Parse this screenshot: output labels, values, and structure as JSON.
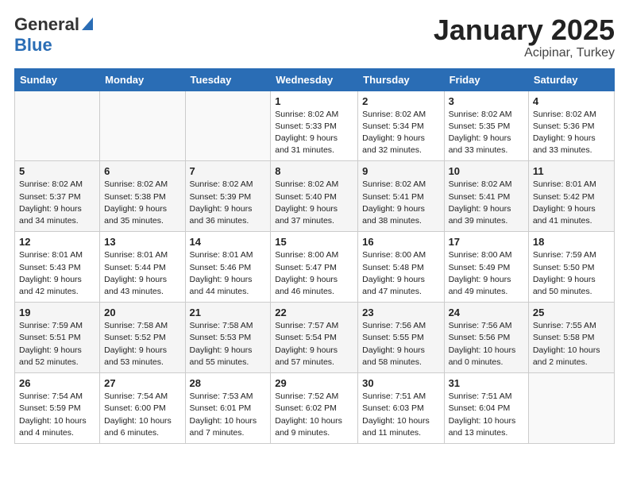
{
  "header": {
    "logo_line1": "General",
    "logo_line2": "Blue",
    "month": "January 2025",
    "location": "Acipinar, Turkey"
  },
  "days_of_week": [
    "Sunday",
    "Monday",
    "Tuesday",
    "Wednesday",
    "Thursday",
    "Friday",
    "Saturday"
  ],
  "weeks": [
    [
      {
        "day": "",
        "info": ""
      },
      {
        "day": "",
        "info": ""
      },
      {
        "day": "",
        "info": ""
      },
      {
        "day": "1",
        "info": "Sunrise: 8:02 AM\nSunset: 5:33 PM\nDaylight: 9 hours\nand 31 minutes."
      },
      {
        "day": "2",
        "info": "Sunrise: 8:02 AM\nSunset: 5:34 PM\nDaylight: 9 hours\nand 32 minutes."
      },
      {
        "day": "3",
        "info": "Sunrise: 8:02 AM\nSunset: 5:35 PM\nDaylight: 9 hours\nand 33 minutes."
      },
      {
        "day": "4",
        "info": "Sunrise: 8:02 AM\nSunset: 5:36 PM\nDaylight: 9 hours\nand 33 minutes."
      }
    ],
    [
      {
        "day": "5",
        "info": "Sunrise: 8:02 AM\nSunset: 5:37 PM\nDaylight: 9 hours\nand 34 minutes."
      },
      {
        "day": "6",
        "info": "Sunrise: 8:02 AM\nSunset: 5:38 PM\nDaylight: 9 hours\nand 35 minutes."
      },
      {
        "day": "7",
        "info": "Sunrise: 8:02 AM\nSunset: 5:39 PM\nDaylight: 9 hours\nand 36 minutes."
      },
      {
        "day": "8",
        "info": "Sunrise: 8:02 AM\nSunset: 5:40 PM\nDaylight: 9 hours\nand 37 minutes."
      },
      {
        "day": "9",
        "info": "Sunrise: 8:02 AM\nSunset: 5:41 PM\nDaylight: 9 hours\nand 38 minutes."
      },
      {
        "day": "10",
        "info": "Sunrise: 8:02 AM\nSunset: 5:41 PM\nDaylight: 9 hours\nand 39 minutes."
      },
      {
        "day": "11",
        "info": "Sunrise: 8:01 AM\nSunset: 5:42 PM\nDaylight: 9 hours\nand 41 minutes."
      }
    ],
    [
      {
        "day": "12",
        "info": "Sunrise: 8:01 AM\nSunset: 5:43 PM\nDaylight: 9 hours\nand 42 minutes."
      },
      {
        "day": "13",
        "info": "Sunrise: 8:01 AM\nSunset: 5:44 PM\nDaylight: 9 hours\nand 43 minutes."
      },
      {
        "day": "14",
        "info": "Sunrise: 8:01 AM\nSunset: 5:46 PM\nDaylight: 9 hours\nand 44 minutes."
      },
      {
        "day": "15",
        "info": "Sunrise: 8:00 AM\nSunset: 5:47 PM\nDaylight: 9 hours\nand 46 minutes."
      },
      {
        "day": "16",
        "info": "Sunrise: 8:00 AM\nSunset: 5:48 PM\nDaylight: 9 hours\nand 47 minutes."
      },
      {
        "day": "17",
        "info": "Sunrise: 8:00 AM\nSunset: 5:49 PM\nDaylight: 9 hours\nand 49 minutes."
      },
      {
        "day": "18",
        "info": "Sunrise: 7:59 AM\nSunset: 5:50 PM\nDaylight: 9 hours\nand 50 minutes."
      }
    ],
    [
      {
        "day": "19",
        "info": "Sunrise: 7:59 AM\nSunset: 5:51 PM\nDaylight: 9 hours\nand 52 minutes."
      },
      {
        "day": "20",
        "info": "Sunrise: 7:58 AM\nSunset: 5:52 PM\nDaylight: 9 hours\nand 53 minutes."
      },
      {
        "day": "21",
        "info": "Sunrise: 7:58 AM\nSunset: 5:53 PM\nDaylight: 9 hours\nand 55 minutes."
      },
      {
        "day": "22",
        "info": "Sunrise: 7:57 AM\nSunset: 5:54 PM\nDaylight: 9 hours\nand 57 minutes."
      },
      {
        "day": "23",
        "info": "Sunrise: 7:56 AM\nSunset: 5:55 PM\nDaylight: 9 hours\nand 58 minutes."
      },
      {
        "day": "24",
        "info": "Sunrise: 7:56 AM\nSunset: 5:56 PM\nDaylight: 10 hours\nand 0 minutes."
      },
      {
        "day": "25",
        "info": "Sunrise: 7:55 AM\nSunset: 5:58 PM\nDaylight: 10 hours\nand 2 minutes."
      }
    ],
    [
      {
        "day": "26",
        "info": "Sunrise: 7:54 AM\nSunset: 5:59 PM\nDaylight: 10 hours\nand 4 minutes."
      },
      {
        "day": "27",
        "info": "Sunrise: 7:54 AM\nSunset: 6:00 PM\nDaylight: 10 hours\nand 6 minutes."
      },
      {
        "day": "28",
        "info": "Sunrise: 7:53 AM\nSunset: 6:01 PM\nDaylight: 10 hours\nand 7 minutes."
      },
      {
        "day": "29",
        "info": "Sunrise: 7:52 AM\nSunset: 6:02 PM\nDaylight: 10 hours\nand 9 minutes."
      },
      {
        "day": "30",
        "info": "Sunrise: 7:51 AM\nSunset: 6:03 PM\nDaylight: 10 hours\nand 11 minutes."
      },
      {
        "day": "31",
        "info": "Sunrise: 7:51 AM\nSunset: 6:04 PM\nDaylight: 10 hours\nand 13 minutes."
      },
      {
        "day": "",
        "info": ""
      }
    ]
  ]
}
